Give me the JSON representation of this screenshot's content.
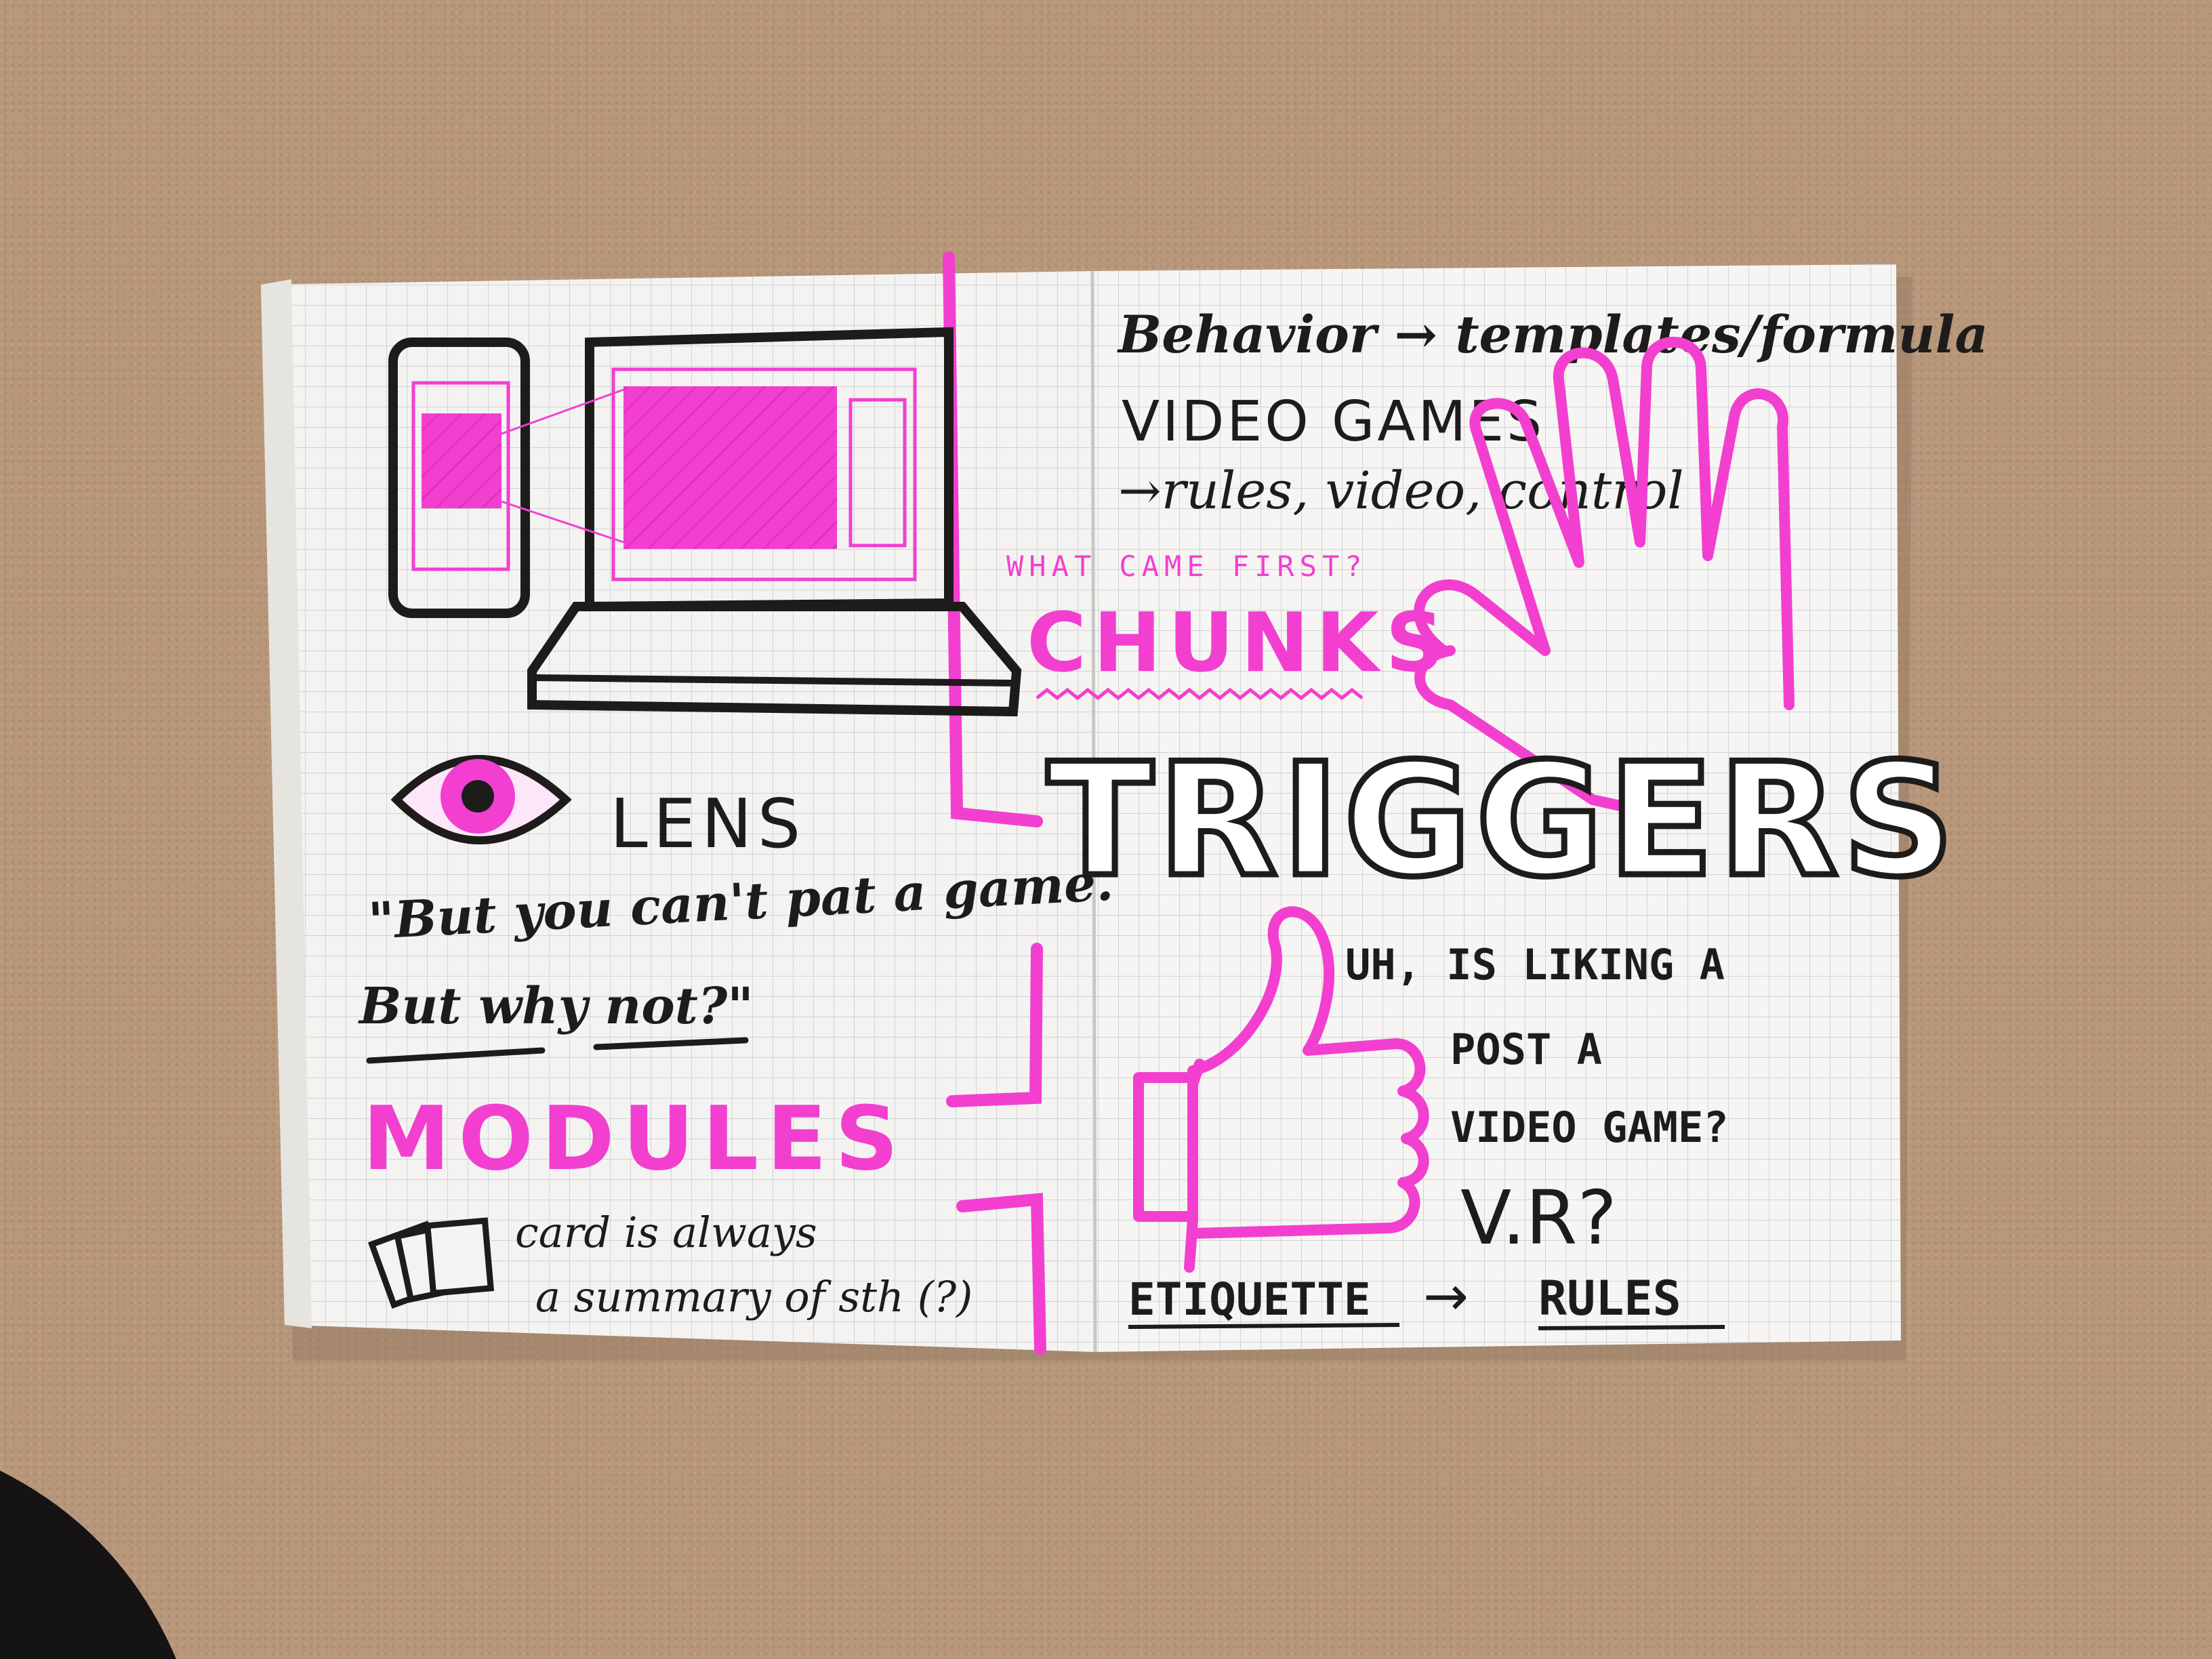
{
  "colors": {
    "carpet": "#b8977a",
    "paper": "#f4f3f1",
    "grid": "#cfd3d8",
    "ink": "#1e1b1b",
    "highlighter": "#f23fd0"
  },
  "left_page": {
    "lens": "LENS",
    "quote_line1": "\"But you can't pat a game.",
    "quote_line2": "But why not?\"",
    "modules": "MODULES",
    "card_line1": "card is always",
    "card_line2": "a summary of sth (?)"
  },
  "right_page": {
    "behavior": "Behavior → templates/formula",
    "video_games": "VIDEO GAMES",
    "rules_line": "→rules, video, control",
    "what_came_first": "WHAT CAME FIRST?",
    "chunks": "CHUNKS",
    "triggers": "TRIGGERS",
    "liking_line1": "UH, IS LIKING A",
    "liking_line2": "POST A",
    "liking_line3": "VIDEO GAME?",
    "vr": "V.R?",
    "etiquette": "ETIQUETTE",
    "arrow": "→",
    "rules": "RULES"
  },
  "icons": [
    "phone-sketch-icon",
    "laptop-sketch-icon",
    "eye-icon",
    "cards-icon",
    "hand-icon",
    "thumbs-up-icon"
  ]
}
